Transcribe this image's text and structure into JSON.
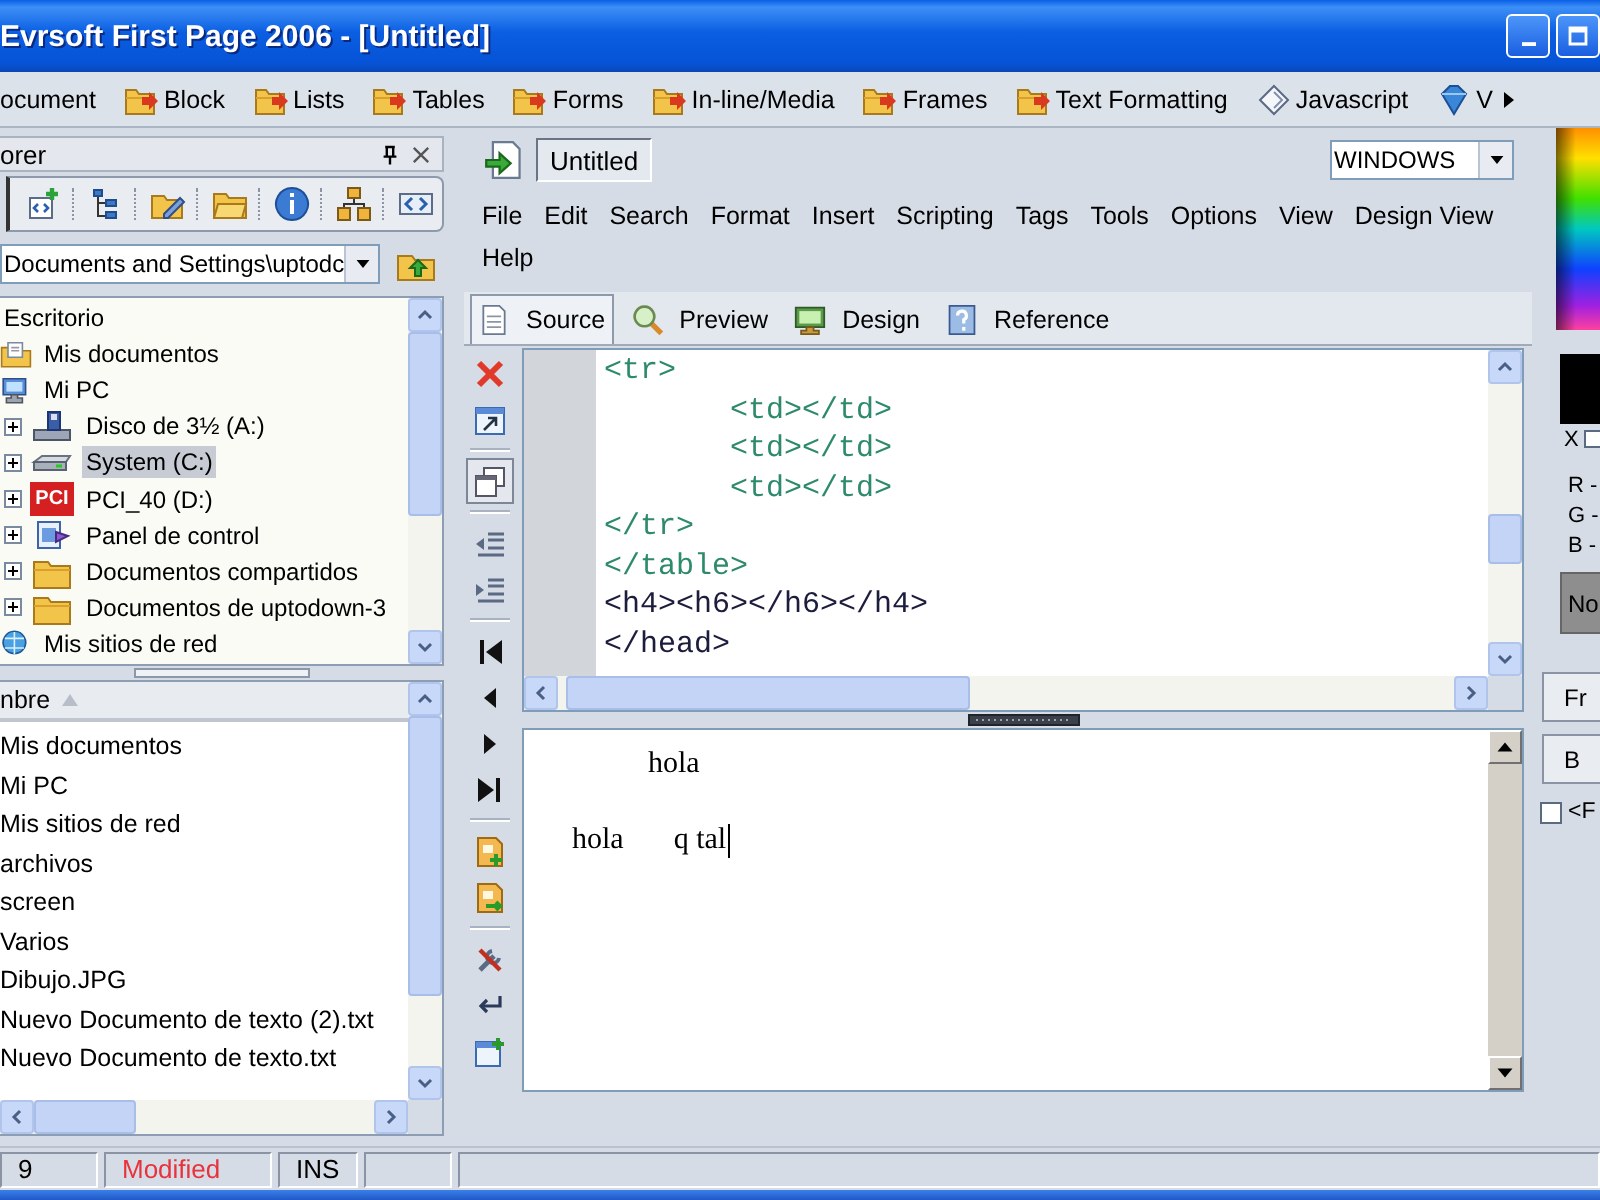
{
  "window": {
    "title": "Evrsoft First Page 2006 - [Untitled]"
  },
  "toolbar": [
    {
      "label": "ocument"
    },
    {
      "label": "Block",
      "kind": "folder"
    },
    {
      "label": "Lists",
      "kind": "folder"
    },
    {
      "label": "Tables",
      "kind": "folder"
    },
    {
      "label": "Forms",
      "kind": "folder"
    },
    {
      "label": "In-line/Media",
      "kind": "folder"
    },
    {
      "label": "Frames",
      "kind": "folder"
    },
    {
      "label": "Text Formatting",
      "kind": "folder"
    },
    {
      "label": "Javascript",
      "kind": "script"
    },
    {
      "label": "V",
      "kind": "gem"
    }
  ],
  "explorer": {
    "title": "orer",
    "path": "Documents and Settings\\uptodc",
    "tree": [
      {
        "label": "Escritorio",
        "selected": false,
        "children": [
          {
            "label": "Mis documentos",
            "kind": "documents",
            "selected": false
          },
          {
            "label": "Mi PC",
            "kind": "computer",
            "selected": false,
            "children": [
              {
                "label": "Disco de 3½ (A:)",
                "kind": "floppy",
                "expanded": false,
                "selected": false
              },
              {
                "label": "System (C:)",
                "kind": "disk",
                "expanded": false,
                "selected": true
              },
              {
                "label": "PCI_40 (D:)",
                "kind": "drive-logo",
                "logo": "PCI",
                "expanded": false,
                "selected": false
              },
              {
                "label": "Panel de control",
                "kind": "control-panel",
                "expanded": false,
                "selected": false
              },
              {
                "label": "Documentos compartidos",
                "kind": "folder",
                "expanded": false,
                "selected": false
              },
              {
                "label": "Documentos de uptodown-3",
                "kind": "folder",
                "expanded": false,
                "selected": false
              }
            ]
          },
          {
            "label": "Mis sitios de red",
            "kind": "network",
            "selected": false
          }
        ]
      }
    ],
    "files": {
      "column": "nbre",
      "sort_ascending": true,
      "rows": [
        "Mis documentos",
        "Mi PC",
        "Mis sitios de red",
        "archivos",
        "screen",
        "Varios",
        "Dibujo.JPG",
        "Nuevo Documento de texto (2).txt",
        "Nuevo Documento de texto.txt"
      ]
    }
  },
  "editor": {
    "doc_tabs": [
      {
        "label": "Untitled",
        "selected": true
      }
    ],
    "line_ending": "WINDOWS",
    "menu": [
      "File",
      "Edit",
      "Search",
      "Format",
      "Insert",
      "Scripting",
      "Tags",
      "Tools",
      "Options",
      "View",
      "Design View",
      "Help"
    ],
    "view_tabs": [
      {
        "label": "Source",
        "kind": "source",
        "selected": true
      },
      {
        "label": "Preview",
        "kind": "preview",
        "selected": false
      },
      {
        "label": "Design",
        "kind": "design",
        "selected": false
      },
      {
        "label": "Reference",
        "kind": "reference",
        "selected": false
      }
    ],
    "side_toolbar": [
      {
        "tools": [
          {
            "kind": "delete",
            "pressed": false
          },
          {
            "kind": "popout",
            "pressed": false
          }
        ]
      },
      {
        "tools": [
          {
            "kind": "windows",
            "pressed": true
          }
        ]
      },
      {
        "tools": [
          {
            "kind": "outdent",
            "pressed": false
          },
          {
            "kind": "indent",
            "pressed": false
          }
        ]
      },
      {
        "tools": [
          {
            "kind": "first",
            "pressed": false
          },
          {
            "kind": "previous",
            "pressed": false
          },
          {
            "kind": "next",
            "pressed": false
          },
          {
            "kind": "last",
            "pressed": false
          }
        ]
      },
      {
        "tools": [
          {
            "kind": "add-document",
            "pressed": false
          },
          {
            "kind": "swap-document",
            "pressed": false
          }
        ]
      },
      {
        "tools": [
          {
            "kind": "tools",
            "pressed": false
          },
          {
            "kind": "wrap",
            "pressed": false
          },
          {
            "kind": "add-window",
            "pressed": false
          }
        ]
      }
    ],
    "code_lines": [
      {
        "text": "<tr>",
        "color": "#2e8a6c"
      },
      {
        "text": "\t<td></td>",
        "color": "#2e8a6c"
      },
      {
        "text": "\t<td></td>",
        "color": "#2e8a6c"
      },
      {
        "text": "\t<td></td>",
        "color": "#2e8a6c"
      },
      {
        "text": "</tr>",
        "color": "#2e8a6c"
      },
      {
        "text": "</table>",
        "color": "#2e8a6c"
      },
      {
        "text": "<h4><h6></h6></h4>",
        "color": "#1c1c3c"
      },
      {
        "text": "</head>",
        "color": "#1c1c3c"
      }
    ],
    "preview": {
      "lines": [
        {
          "kind": "indented",
          "words": [
            "hola"
          ],
          "cursor": false
        },
        {
          "kind": "plain",
          "words": [
            "hola",
            "q tal"
          ],
          "cursor": true
        }
      ]
    }
  },
  "color_panel": {
    "color": "#000000",
    "transparent": {
      "label": "X",
      "checked": false
    },
    "channels": [
      "R -",
      "G -",
      "B -"
    ],
    "no_color": "No",
    "buttons": [
      "Fr",
      "B"
    ],
    "option": {
      "label": "<F",
      "checked": false
    }
  },
  "status_bar": [
    {
      "text": "9",
      "color": "#000000"
    },
    {
      "text": "Modified",
      "color": "#e8323c"
    },
    {
      "text": "INS",
      "color": "#000000"
    }
  ]
}
